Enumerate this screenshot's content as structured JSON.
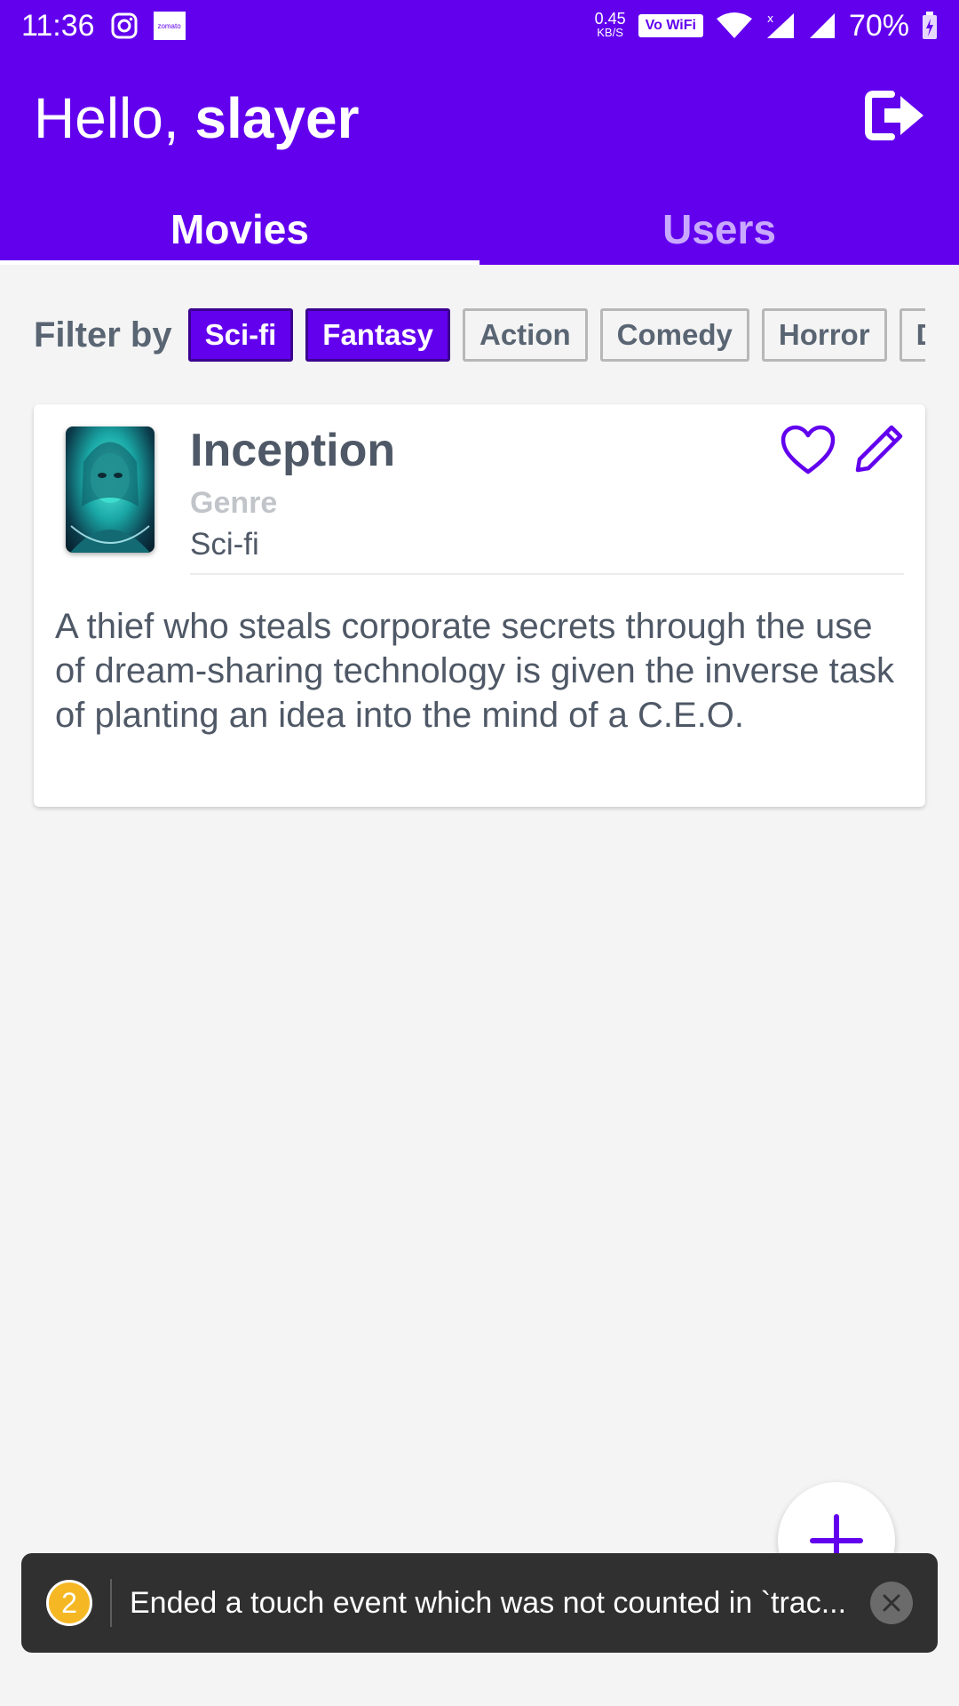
{
  "status_bar": {
    "time": "11:36",
    "speed_value": "0.45",
    "speed_unit": "KB/S",
    "wifi_badge": "Vo WiFi",
    "battery": "70%",
    "zomato_label": "zomato"
  },
  "app_bar": {
    "greeting_prefix": "Hello, ",
    "username": "slayer",
    "accent_color": "#6200ee"
  },
  "tabs": [
    {
      "label": "Movies",
      "active": true
    },
    {
      "label": "Users",
      "active": false
    }
  ],
  "filter": {
    "label": "Filter by",
    "chips": [
      {
        "label": "Sci-fi",
        "selected": true
      },
      {
        "label": "Fantasy",
        "selected": true
      },
      {
        "label": "Action",
        "selected": false
      },
      {
        "label": "Comedy",
        "selected": false
      },
      {
        "label": "Horror",
        "selected": false
      },
      {
        "label": "Drama",
        "selected": false
      }
    ]
  },
  "movies": [
    {
      "title": "Inception",
      "genre_label": "Genre",
      "genre": "Sci-fi",
      "description": "A thief who steals corporate secrets through the use of dream-sharing technology is given the inverse task of planting an idea into the mind of a C.E.O."
    }
  ],
  "toast": {
    "count": "2",
    "message": "Ended a touch event which was not counted in `trac..."
  },
  "icons": {
    "logout": "logout-icon",
    "favorite": "heart-outline-icon",
    "edit": "pencil-icon",
    "add": "plus-icon",
    "close": "close-icon"
  }
}
